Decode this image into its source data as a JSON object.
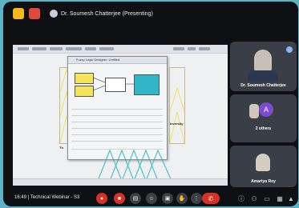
{
  "meeting": {
    "presenter_label": "Dr. Soumesh Chatterjee (Presenting)",
    "time": "16:49",
    "separator": "|",
    "title": "Technical Webinar - S3"
  },
  "slide": {
    "left_text": "Th",
    "right_text": "Inversity",
    "dialog_title": "Fuzzy Logic Designer: Untitled",
    "center_block_label": "",
    "taskbar_text": ""
  },
  "participants": [
    {
      "name": "Dr. Soumesh Chatterjee",
      "type": "video"
    },
    {
      "name": "2 others",
      "type": "avatar",
      "avatar_letter": "A"
    },
    {
      "name": "Amartya Roy",
      "type": "video"
    }
  ],
  "controls": {
    "end_call_icon": "phone-hangup-icon"
  },
  "colors": {
    "background": "#5fb2c4",
    "bezel": "#0e1014",
    "tile": "#3a3f47",
    "accent_red": "#d93025",
    "app_icon_yellow": "#f2b81c",
    "app_icon_red": "#e04a3a",
    "avatar_purple": "#7b4bd1",
    "mf_cyan": "#2fb6c7",
    "mf_yellow": "#f4e35b"
  }
}
